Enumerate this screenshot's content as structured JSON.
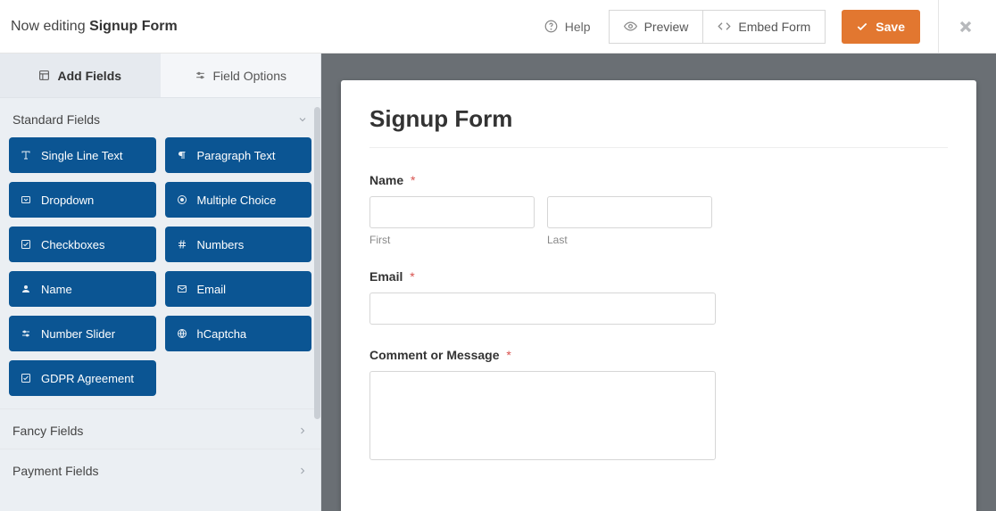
{
  "header": {
    "editing_prefix": "Now editing",
    "form_name": "Signup Form",
    "help_label": "Help",
    "preview_label": "Preview",
    "embed_label": "Embed Form",
    "save_label": "Save"
  },
  "sidebar": {
    "tabs": {
      "add_fields": "Add Fields",
      "field_options": "Field Options"
    },
    "groups": {
      "standard": "Standard Fields",
      "fancy": "Fancy Fields",
      "payment": "Payment Fields"
    },
    "standard_fields": [
      {
        "label": "Single Line Text",
        "icon": "text-icon"
      },
      {
        "label": "Paragraph Text",
        "icon": "paragraph-icon"
      },
      {
        "label": "Dropdown",
        "icon": "dropdown-icon"
      },
      {
        "label": "Multiple Choice",
        "icon": "radio-icon"
      },
      {
        "label": "Checkboxes",
        "icon": "check-icon"
      },
      {
        "label": "Numbers",
        "icon": "hash-icon"
      },
      {
        "label": "Name",
        "icon": "user-icon"
      },
      {
        "label": "Email",
        "icon": "envelope-icon"
      },
      {
        "label": "Number Slider",
        "icon": "sliders-icon"
      },
      {
        "label": "hCaptcha",
        "icon": "globe-icon"
      },
      {
        "label": "GDPR Agreement",
        "icon": "check-icon"
      }
    ]
  },
  "form": {
    "title": "Signup Form",
    "name_label": "Name",
    "first_label": "First",
    "last_label": "Last",
    "email_label": "Email",
    "comment_label": "Comment or Message",
    "required_marker": "*"
  }
}
